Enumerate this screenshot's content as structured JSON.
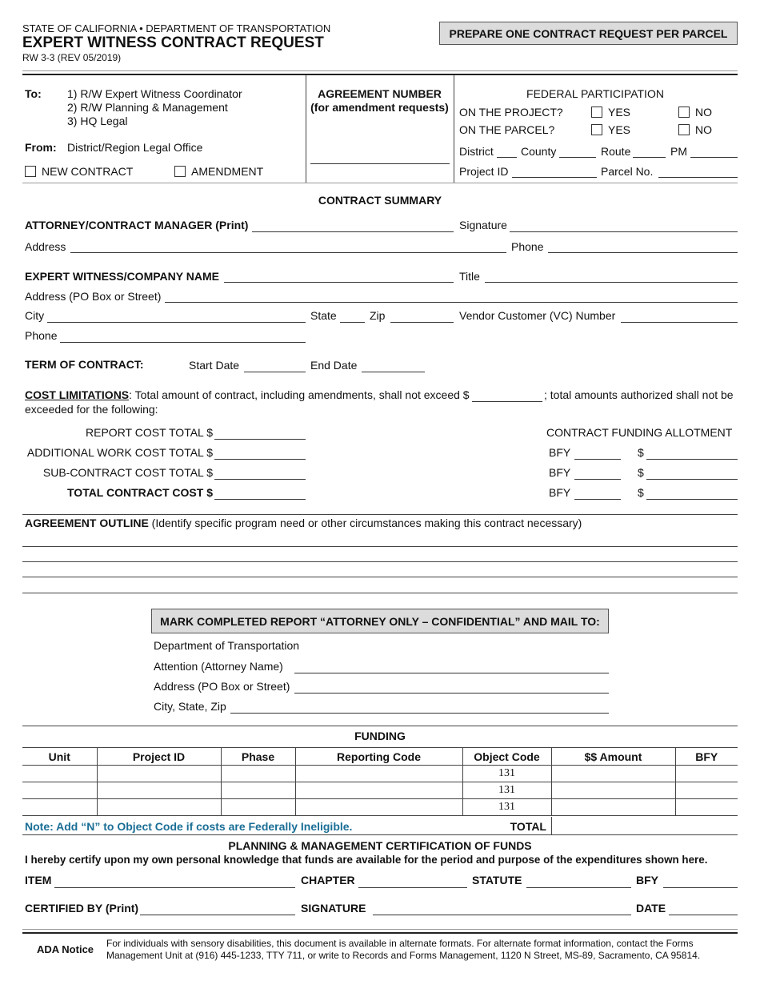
{
  "header": {
    "agency": "STATE OF CALIFORNIA • DEPARTMENT OF TRANSPORTATION",
    "title": "EXPERT WITNESS CONTRACT REQUEST",
    "form_number": "RW 3-3 (REV 05/2019)",
    "notice_box": "PREPARE ONE CONTRACT REQUEST PER PARCEL"
  },
  "routing": {
    "to_label": "To:",
    "to_items": [
      "1)  R/W Expert Witness Coordinator",
      "2)  R/W Planning & Management",
      "3)  HQ Legal"
    ],
    "from_label": "From:",
    "from_value": "District/Region Legal Office",
    "new_contract_label": "NEW CONTRACT",
    "amendment_label": "AMENDMENT"
  },
  "agreement_number": {
    "title": "AGREEMENT NUMBER",
    "subtitle": "(for amendment requests)",
    "value": ""
  },
  "federal_participation": {
    "title": "FEDERAL PARTICIPATION",
    "project_question": "ON THE PROJECT?",
    "parcel_question": "ON THE PARCEL?",
    "yes_label": "YES",
    "no_label": "NO",
    "district_label": "District",
    "county_label": "County",
    "route_label": "Route",
    "pm_label": "PM",
    "project_id_label": "Project ID",
    "parcel_no_label": "Parcel No."
  },
  "contract_summary": {
    "title": "CONTRACT SUMMARY",
    "attorney_label": "ATTORNEY/CONTRACT MANAGER (Print)",
    "signature_label": "Signature",
    "address_label": "Address",
    "phone_label": "Phone",
    "expert_label": "EXPERT WITNESS/COMPANY NAME",
    "title_label": "Title",
    "expert_address_label": "Address (PO Box or Street)",
    "city_label": "City",
    "state_label": "State",
    "zip_label": "Zip",
    "vc_label": "Vendor Customer (VC) Number",
    "expert_phone_label": "Phone",
    "term_label": "TERM OF CONTRACT:",
    "start_date_label": "Start Date",
    "end_date_label": "End Date"
  },
  "cost_limitations": {
    "heading": "COST LIMITATIONS",
    "text_part1": ": Total amount of contract, including amendments, shall not exceed $",
    "text_part2": "; total amounts authorized shall not be",
    "text_line2": "exceeded for the following:",
    "report_cost_label": "REPORT COST TOTAL $",
    "additional_cost_label": "ADDITIONAL WORK COST TOTAL $",
    "subcontract_cost_label": "SUB-CONTRACT COST TOTAL $",
    "total_cost_label": "TOTAL CONTRACT COST $",
    "funding_allotment_title": "CONTRACT FUNDING ALLOTMENT",
    "bfy_label": "BFY",
    "dollar_label": "$"
  },
  "agreement_outline": {
    "heading": "AGREEMENT OUTLINE",
    "description": " (Identify specific program need or other circumstances making this contract necessary)"
  },
  "mail_to": {
    "box_text": "MARK COMPLETED REPORT “ATTORNEY ONLY – CONFIDENTIAL” AND MAIL TO:",
    "department": "Department of Transportation",
    "attention_label": "Attention (Attorney Name)",
    "address_label": "Address (PO Box or Street)",
    "city_label": "City, State, Zip"
  },
  "funding": {
    "title": "FUNDING",
    "columns": [
      "Unit",
      "Project ID",
      "Phase",
      "Reporting Code",
      "Object Code",
      "$$ Amount",
      "BFY"
    ],
    "rows": [
      [
        "",
        "",
        "",
        "",
        "131",
        "",
        ""
      ],
      [
        "",
        "",
        "",
        "",
        "131",
        "",
        ""
      ],
      [
        "",
        "",
        "",
        "",
        "131",
        "",
        ""
      ]
    ],
    "note": "Note: Add “N” to Object Code if costs are Federally Ineligible.",
    "total_label": "TOTAL",
    "note_color": "#1a6e96"
  },
  "certification": {
    "title": "PLANNING & MANAGEMENT CERTIFICATION OF FUNDS",
    "statement": "I hereby certify upon my own personal knowledge that funds are available for the period and purpose of the expenditures shown here.",
    "item_label": "ITEM",
    "chapter_label": "CHAPTER",
    "statute_label": "STATUTE",
    "bfy_label": "BFY",
    "certified_by_label": "CERTIFIED BY (Print)",
    "signature_label": "SIGNATURE",
    "date_label": "DATE"
  },
  "ada": {
    "label": "ADA Notice",
    "line1": "For individuals with sensory disabilities, this document is available in alternate formats. For alternate format information, contact the Forms",
    "line2": "Management Unit at (916) 445-1233, TTY 711, or write to Records and Forms Management, 1120 N Street, MS-89, Sacramento, CA 95814."
  }
}
